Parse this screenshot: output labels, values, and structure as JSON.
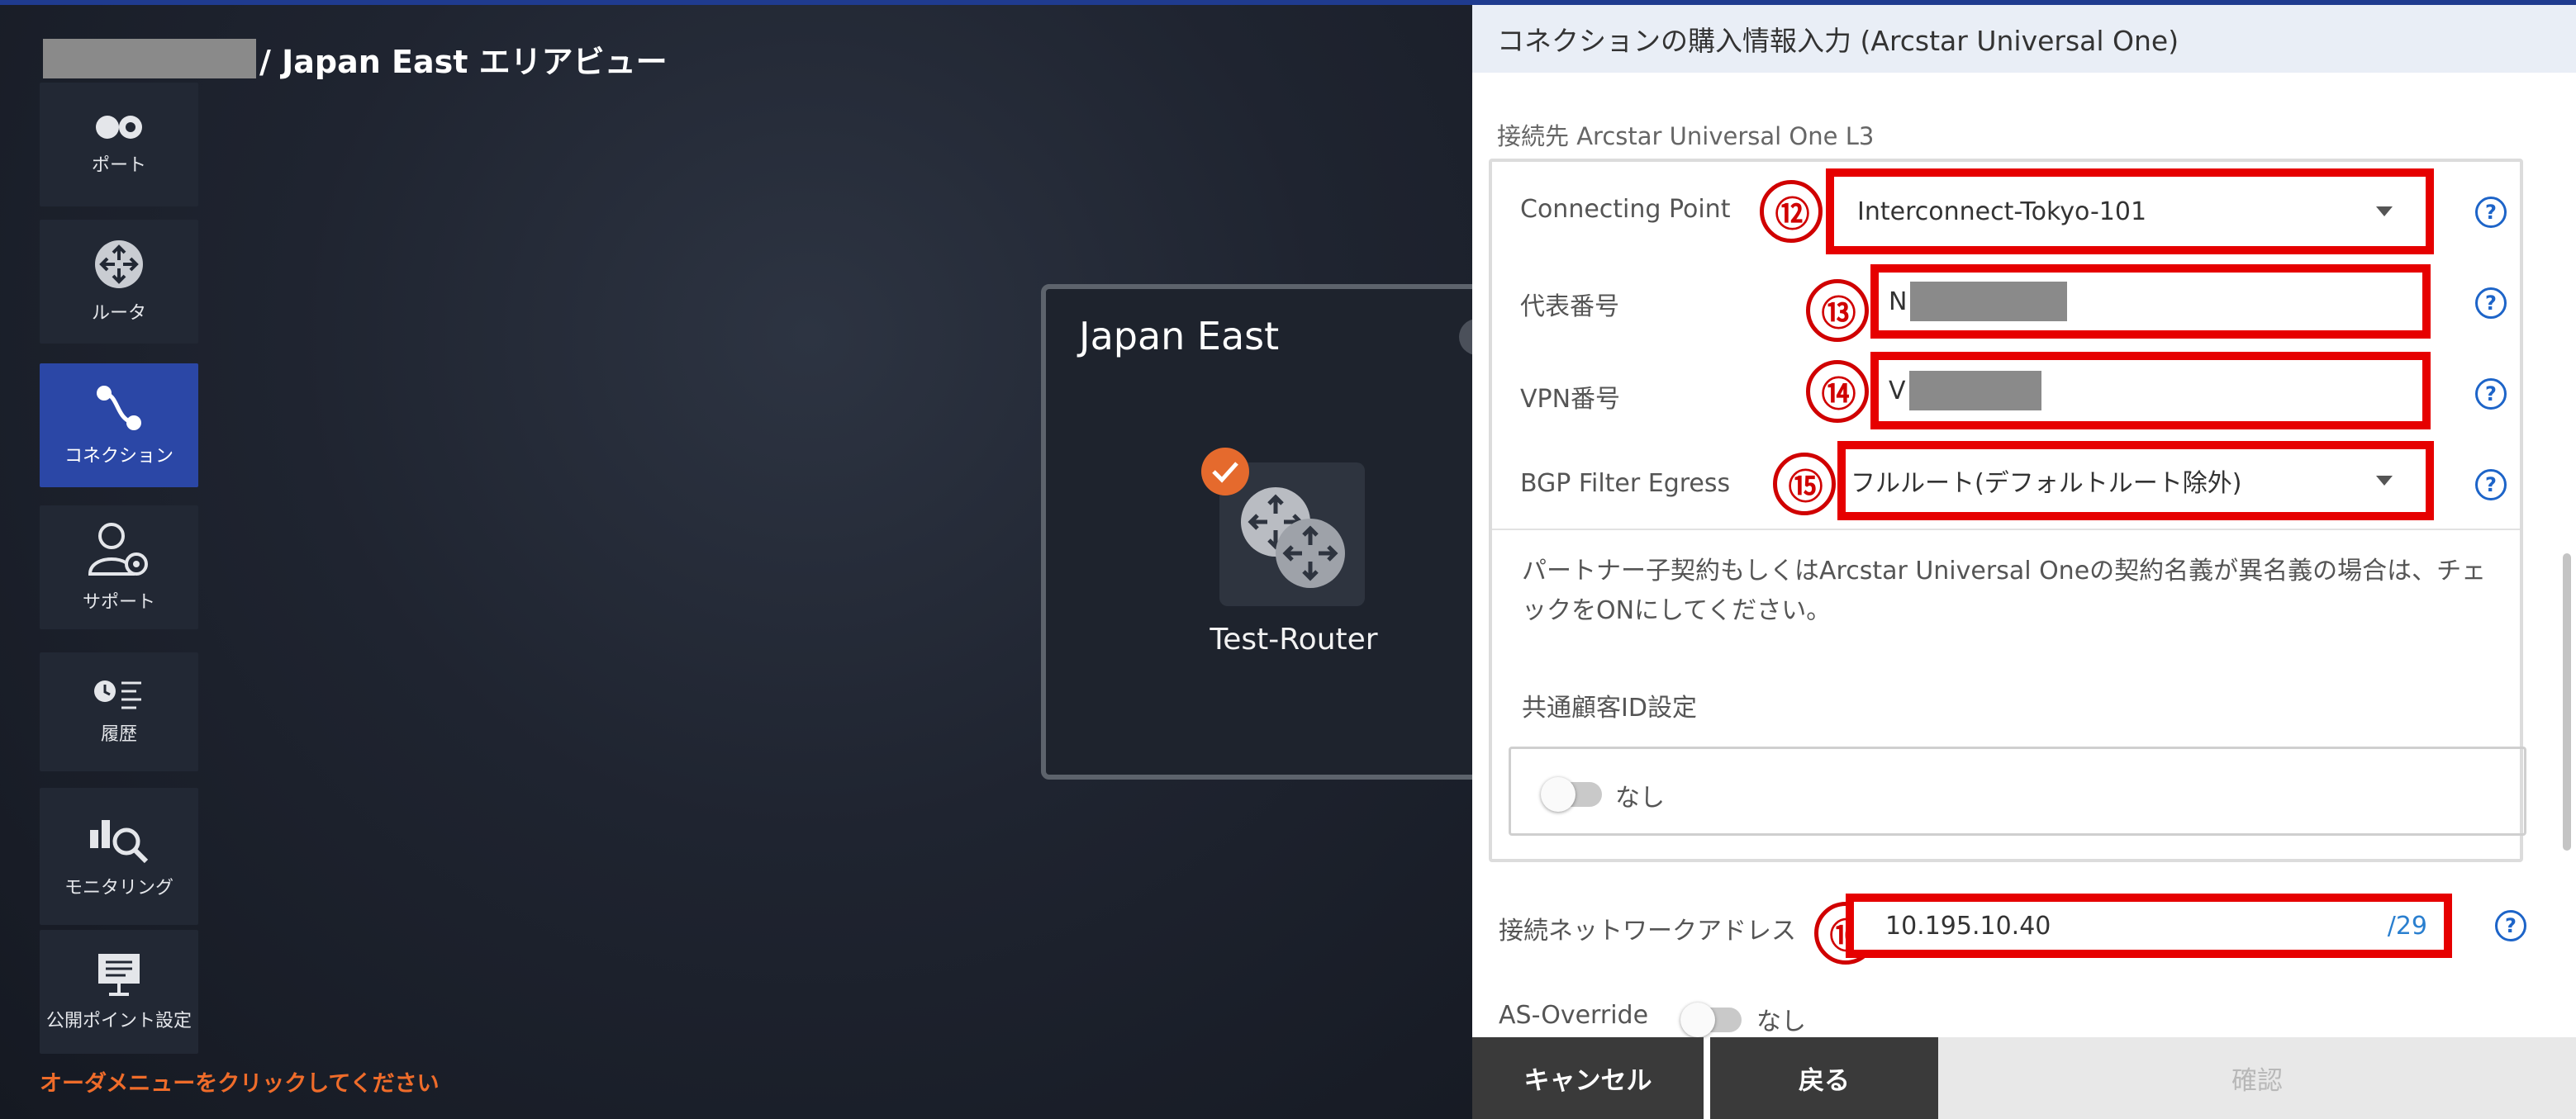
{
  "breadcrumb": {
    "area_text": "/ Japan East エリアビュー"
  },
  "sidebar": {
    "items": [
      {
        "label": "ポート",
        "icon": "port-icon"
      },
      {
        "label": "ルータ",
        "icon": "router-icon"
      },
      {
        "label": "コネクション",
        "icon": "connection-icon",
        "active": true
      },
      {
        "label": "サポート",
        "icon": "support-icon"
      },
      {
        "label": "履歴",
        "icon": "history-icon"
      },
      {
        "label": "モニタリング",
        "icon": "monitoring-icon"
      },
      {
        "label": "公開ポイント設定",
        "icon": "public-point-icon"
      }
    ],
    "order_hint": "オーダメニューをクリックしてください"
  },
  "canvas": {
    "area_title": "Japan East",
    "router_name": "Test-Router"
  },
  "panel": {
    "title": "コネクションの購入情報入力 (Arcstar Universal One)",
    "section_caption": "接続先 Arcstar Universal One L3",
    "fields": {
      "connecting_point": {
        "label": "Connecting Point",
        "value": "Interconnect-Tokyo-101",
        "marker": "⑫"
      },
      "representative_number": {
        "label": "代表番号",
        "value": "N",
        "marker": "⑬"
      },
      "vpn_number": {
        "label": "VPN番号",
        "value": "V",
        "marker": "⑭"
      },
      "bgp_filter_egress": {
        "label": "BGP Filter Egress",
        "value": "フルルート(デフォルトルート除外)",
        "marker": "⑮"
      },
      "network_address": {
        "label": "接続ネットワークアドレス",
        "value": "10.195.10.40",
        "prefix": "/29",
        "marker": "⑯"
      },
      "as_override": {
        "label": "AS-Override",
        "toggle_label": "なし"
      }
    },
    "note": "パートナー子契約もしくはArcstar Universal Oneの契約名義が異名義の場合は、チェックをONにしてください。",
    "common_customer_id": {
      "label": "共通顧客ID設定",
      "toggle_label": "なし"
    },
    "help_glyph": "?",
    "buttons": {
      "cancel": "キャンセル",
      "back": "戻る",
      "confirm": "確認"
    }
  },
  "colors": {
    "accent": "#2b47a6",
    "annotation_red": "#e60000",
    "warning_orange": "#ef6c2a",
    "help_blue": "#1d64c8"
  }
}
